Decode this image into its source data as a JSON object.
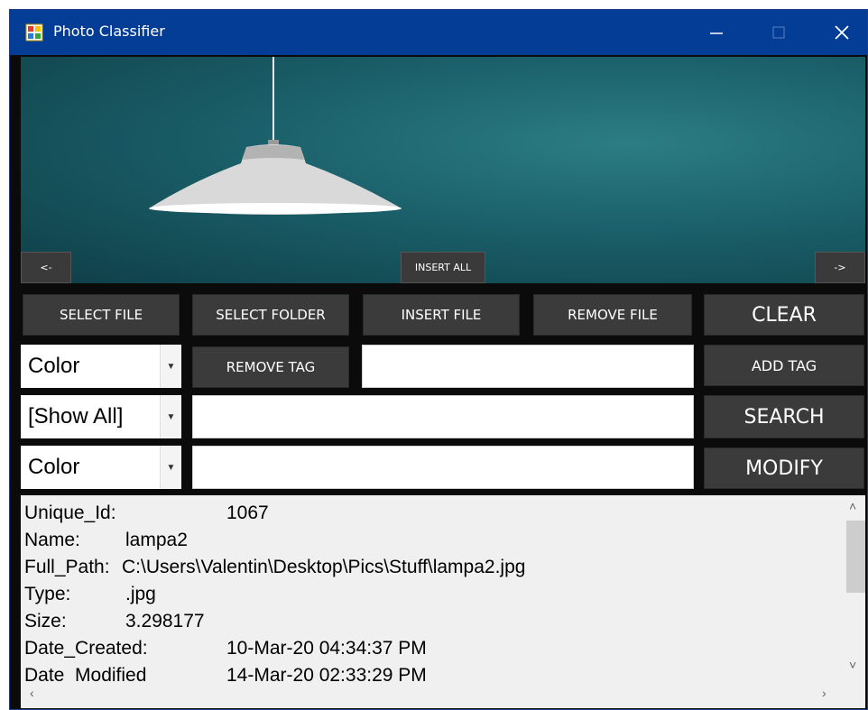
{
  "window": {
    "title": "Photo Classifier"
  },
  "photo_nav": {
    "prev_label": "<-",
    "insert_all_label": "INSERT ALL",
    "next_label": "->"
  },
  "toolbar": {
    "select_file": "SELECT FILE",
    "select_folder": "SELECT FOLDER",
    "insert_file": "INSERT FILE",
    "remove_file": "REMOVE FILE",
    "clear": "CLEAR"
  },
  "tag_row": {
    "combo_value": "Color",
    "remove_tag": "REMOVE TAG",
    "tag_input_value": "",
    "add_tag": "ADD TAG"
  },
  "search_row": {
    "combo_value": "[Show All]",
    "search_input_value": "",
    "search": "SEARCH"
  },
  "modify_row": {
    "combo_value": "Color",
    "modify_input_value": "",
    "modify": "MODIFY"
  },
  "details": [
    {
      "key": "Unique_Id:",
      "value": "1067"
    },
    {
      "key": "Name:",
      "value": "lampa2"
    },
    {
      "key": "Full_Path:",
      "value": "C:\\Users\\Valentin\\Desktop\\Pics\\Stuff\\lampa2.jpg"
    },
    {
      "key": "Type:",
      "value": ".jpg"
    },
    {
      "key": "Size:",
      "value": "3.298177"
    },
    {
      "key": "Date_Created:",
      "value": "10-Mar-20 04:34:37 PM"
    },
    {
      "key": "Date_Modified",
      "value": "14-Mar-20 02:33:29 PM"
    }
  ],
  "colors": {
    "titlebar": "#033d95",
    "window_bg": "#0b0b0b",
    "button_bg": "#3b3b3b",
    "photo_teal": "#1a5f69"
  }
}
